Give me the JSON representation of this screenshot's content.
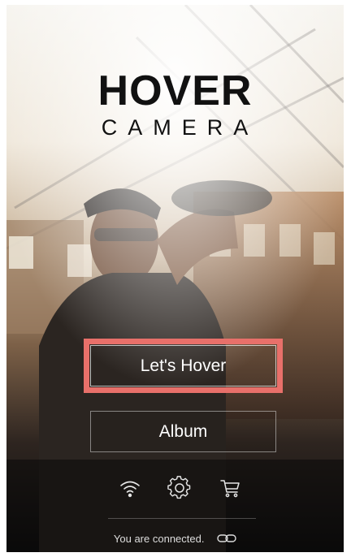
{
  "logo": {
    "main": "HOVER",
    "sub": "CAMERA"
  },
  "buttons": {
    "lets_hover": "Let's Hover",
    "album": "Album"
  },
  "toolbar": {
    "icons": [
      "wifi-icon",
      "gear-icon",
      "cart-icon"
    ]
  },
  "status": {
    "text": "You are connected.",
    "icon": "link-icon"
  },
  "colors": {
    "highlight": "#e8706a"
  }
}
